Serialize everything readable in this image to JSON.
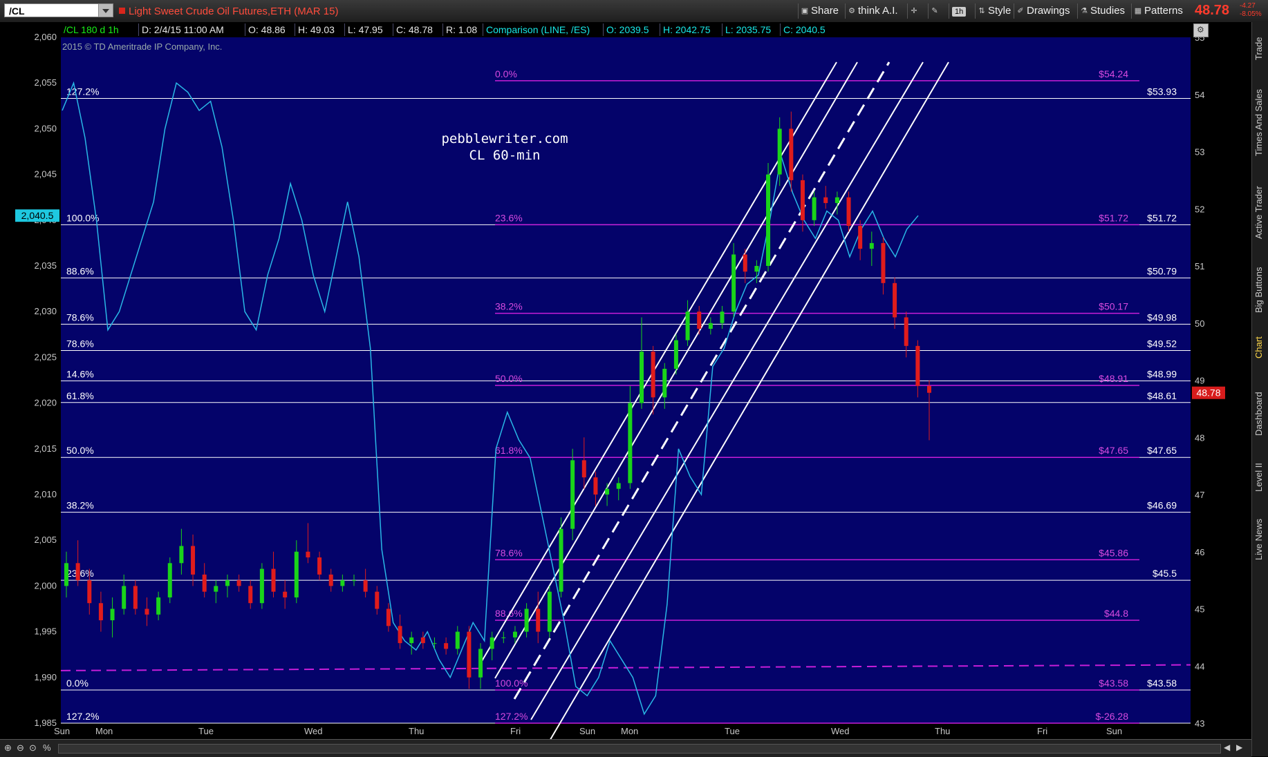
{
  "toolbar": {
    "symbol": "/CL",
    "instrument_title": "Light Sweet Crude Oil Futures,ETH (MAR 15)",
    "share_label": "Share",
    "thinkai_label": "think A.I.",
    "timeframe_badge": "1h",
    "style_label": "Style",
    "drawings_label": "Drawings",
    "studies_label": "Studies",
    "patterns_label": "Patterns",
    "last_price": "48.78",
    "change_abs": "-4.27",
    "change_pct": "-8.05%"
  },
  "infobar": {
    "symbol_period": "/CL 180 d 1h",
    "date": "D: 2/4/15 11:00 AM",
    "open": "O: 48.86",
    "high": "H: 49.03",
    "low": "L: 47.95",
    "close": "C: 48.78",
    "range": "R: 1.08",
    "comparison": "Comparison (LINE, /ES)",
    "cmp_open": "O: 2039.5",
    "cmp_high": "H: 2042.75",
    "cmp_low": "L: 2035.75",
    "cmp_close": "C: 2040.5"
  },
  "watermark": "2015 © TD Ameritrade IP Company, Inc.",
  "annotation": {
    "line1": "pebblewriter.com",
    "line2": "CL 60-min"
  },
  "right_tabs": [
    "Trade",
    "Times And Sales",
    "Active Trader",
    "Big Buttons",
    "Chart",
    "Dashboard",
    "Level II",
    "Live News"
  ],
  "active_tab": "Chart",
  "colors": {
    "background": "#04036a",
    "grid": "#1c1c8a",
    "up": "#1ad41a",
    "down": "#e01c1c",
    "comparison": "#29b8e6",
    "white_fib": "#ffffff",
    "magenta_fib": "#c81ed8",
    "channel": "#ffffff",
    "price_badge": "#d81c1c",
    "cmp_badge": "#1ec8e0"
  },
  "chart_data": {
    "type": "candlestick",
    "primary": "/CL",
    "comparison": "/ES",
    "y_right": {
      "min": 43,
      "max": 55,
      "ticks": [
        43,
        44,
        45,
        46,
        47,
        48,
        49,
        50,
        51,
        52,
        53,
        54,
        55
      ]
    },
    "y_left": {
      "min": 1985,
      "max": 2060,
      "ticks": [
        1985,
        1990,
        1995,
        2000,
        2005,
        2010,
        2015,
        2020,
        2025,
        2030,
        2035,
        2040,
        2045,
        2050,
        2055,
        2060
      ]
    },
    "x_labels": [
      "Sun",
      "Mon",
      "Tue",
      "Wed",
      "Thu",
      "Fri",
      "Sun",
      "Mon",
      "Tue",
      "Wed",
      "Thu",
      "Fri",
      "Sun"
    ],
    "current_price": "48.78",
    "current_cmp": "2,040.5",
    "white_fibs": [
      {
        "label": "127.2%",
        "value": 53.93,
        "price": "$53.93"
      },
      {
        "label": "100.0%",
        "value": 51.72,
        "price": "$51.72"
      },
      {
        "label": "88.6%",
        "value": 50.79,
        "price": "$50.79"
      },
      {
        "label": "78.6%",
        "value": 49.98,
        "price": "$49.98"
      },
      {
        "label": "78.6%",
        "value": 49.52,
        "price": "$49.52"
      },
      {
        "label": "14.6%",
        "value": 48.99,
        "price": "$48.99"
      },
      {
        "label": "61.8%",
        "value": 48.61,
        "price": "$48.61"
      },
      {
        "label": "50.0%",
        "value": 47.65,
        "price": "$47.65"
      },
      {
        "label": "38.2%",
        "value": 46.69,
        "price": "$46.69"
      },
      {
        "label": "23.6%",
        "value": 45.5,
        "price": "$45.5"
      },
      {
        "label": "0.0%",
        "value": 43.58,
        "price": "$43.58"
      },
      {
        "label": "127.2%",
        "value": 43.0,
        "price": ""
      }
    ],
    "magenta_fibs": [
      {
        "label": "0.0%",
        "value": 54.24,
        "price": "$54.24"
      },
      {
        "label": "23.6%",
        "value": 51.72,
        "price": "$51.72"
      },
      {
        "label": "38.2%",
        "value": 50.17,
        "price": "$50.17"
      },
      {
        "label": "50.0%",
        "value": 48.91,
        "price": "$48.91"
      },
      {
        "label": "61.8%",
        "value": 47.65,
        "price": "$47.65"
      },
      {
        "label": "78.6%",
        "value": 45.86,
        "price": "$45.86"
      },
      {
        "label": "88.6%",
        "value": 44.8,
        "price": "$44.8"
      },
      {
        "label": "100.0%",
        "value": 43.58,
        "price": "$43.58"
      },
      {
        "label": "127.2%",
        "value": 43.0,
        "price": "$-26.28"
      }
    ],
    "candles": [
      [
        45.4,
        46.0,
        45.2,
        45.8
      ],
      [
        45.8,
        46.2,
        45.4,
        45.5
      ],
      [
        45.5,
        45.7,
        44.9,
        45.1
      ],
      [
        45.1,
        45.3,
        44.6,
        44.8
      ],
      [
        44.8,
        45.2,
        44.5,
        45.0
      ],
      [
        45.0,
        45.6,
        44.9,
        45.4
      ],
      [
        45.4,
        45.5,
        44.9,
        45.0
      ],
      [
        45.0,
        45.2,
        44.7,
        44.9
      ],
      [
        44.9,
        45.3,
        44.8,
        45.2
      ],
      [
        45.2,
        45.9,
        45.1,
        45.8
      ],
      [
        45.8,
        46.4,
        45.6,
        46.1
      ],
      [
        46.1,
        46.3,
        45.4,
        45.6
      ],
      [
        45.6,
        45.8,
        45.2,
        45.3
      ],
      [
        45.3,
        45.5,
        45.1,
        45.4
      ],
      [
        45.4,
        45.6,
        45.2,
        45.5
      ],
      [
        45.5,
        45.6,
        45.3,
        45.4
      ],
      [
        45.4,
        45.5,
        45.0,
        45.1
      ],
      [
        45.1,
        45.8,
        45.0,
        45.7
      ],
      [
        45.7,
        46.0,
        45.2,
        45.3
      ],
      [
        45.3,
        45.5,
        45.0,
        45.2
      ],
      [
        45.2,
        46.2,
        45.1,
        46.0
      ],
      [
        46.0,
        46.5,
        45.8,
        45.9
      ],
      [
        45.9,
        46.0,
        45.5,
        45.6
      ],
      [
        45.6,
        45.7,
        45.3,
        45.4
      ],
      [
        45.4,
        45.6,
        45.3,
        45.5
      ],
      [
        45.5,
        45.6,
        45.4,
        45.5
      ],
      [
        45.5,
        45.7,
        45.2,
        45.3
      ],
      [
        45.3,
        45.4,
        44.9,
        45.0
      ],
      [
        45.0,
        45.1,
        44.6,
        44.7
      ],
      [
        44.7,
        44.9,
        44.3,
        44.4
      ],
      [
        44.4,
        44.6,
        44.2,
        44.5
      ],
      [
        44.5,
        44.6,
        44.3,
        44.4
      ],
      [
        44.4,
        44.5,
        44.3,
        44.4
      ],
      [
        44.4,
        44.5,
        44.2,
        44.3
      ],
      [
        44.3,
        44.7,
        44.2,
        44.6
      ],
      [
        44.6,
        44.7,
        43.6,
        43.8
      ],
      [
        43.8,
        44.4,
        43.6,
        44.3
      ],
      [
        44.3,
        44.6,
        44.1,
        44.5
      ],
      [
        44.5,
        44.6,
        44.4,
        44.5
      ],
      [
        44.5,
        44.7,
        44.4,
        44.6
      ],
      [
        44.6,
        45.1,
        44.5,
        45.0
      ],
      [
        45.0,
        45.3,
        44.4,
        44.6
      ],
      [
        44.6,
        45.4,
        44.5,
        45.3
      ],
      [
        45.3,
        46.6,
        45.2,
        46.4
      ],
      [
        46.4,
        47.8,
        46.2,
        47.6
      ],
      [
        47.6,
        48.0,
        47.1,
        47.3
      ],
      [
        47.3,
        47.4,
        46.8,
        47.0
      ],
      [
        47.0,
        47.2,
        46.8,
        47.1
      ],
      [
        47.1,
        47.3,
        46.9,
        47.2
      ],
      [
        47.2,
        48.9,
        47.1,
        48.6
      ],
      [
        48.6,
        50.1,
        48.5,
        49.5
      ],
      [
        49.5,
        49.6,
        48.4,
        48.7
      ],
      [
        48.7,
        49.3,
        48.5,
        49.2
      ],
      [
        49.2,
        49.8,
        49.1,
        49.7
      ],
      [
        49.7,
        50.4,
        49.6,
        50.2
      ],
      [
        50.2,
        50.3,
        49.8,
        49.9
      ],
      [
        49.9,
        50.1,
        49.8,
        50.0
      ],
      [
        50.0,
        50.3,
        49.9,
        50.2
      ],
      [
        50.2,
        51.4,
        50.1,
        51.2
      ],
      [
        51.2,
        51.3,
        50.7,
        50.9
      ],
      [
        50.9,
        51.1,
        50.7,
        51.0
      ],
      [
        51.0,
        52.8,
        50.9,
        52.6
      ],
      [
        52.6,
        53.6,
        52.4,
        53.4
      ],
      [
        53.4,
        53.7,
        52.3,
        52.5
      ],
      [
        52.5,
        52.6,
        51.6,
        51.8
      ],
      [
        51.8,
        52.3,
        51.7,
        52.2
      ],
      [
        52.2,
        52.4,
        52.0,
        52.1
      ],
      [
        52.1,
        52.3,
        51.9,
        52.2
      ],
      [
        52.2,
        52.3,
        51.6,
        51.7
      ],
      [
        51.7,
        51.8,
        51.1,
        51.3
      ],
      [
        51.3,
        51.6,
        51.0,
        51.4
      ],
      [
        51.4,
        51.5,
        50.5,
        50.7
      ],
      [
        50.7,
        50.8,
        49.9,
        50.1
      ],
      [
        50.1,
        50.2,
        49.4,
        49.6
      ],
      [
        49.6,
        49.7,
        48.7,
        48.9
      ],
      [
        48.9,
        49.0,
        47.95,
        48.78
      ]
    ],
    "comparison_series": [
      2052,
      2055,
      2049,
      2040,
      2028,
      2030,
      2034,
      2038,
      2042,
      2050,
      2055,
      2054,
      2052,
      2053,
      2048,
      2040,
      2030,
      2028,
      2034,
      2038,
      2044,
      2040,
      2034,
      2030,
      2036,
      2042,
      2036,
      2026,
      2004,
      1996,
      1994,
      1993,
      1995,
      1992,
      1990,
      1993,
      1996,
      1994,
      2015,
      2019,
      2016,
      2014,
      2008,
      2002,
      1996,
      1989,
      1988,
      1990,
      1994,
      1992,
      1990,
      1986,
      1988,
      1998,
      2015,
      2012,
      2010,
      2024,
      2026,
      2030,
      2033,
      2034,
      2040,
      2047,
      2043,
      2040,
      2038,
      2041,
      2040,
      2036,
      2039,
      2041,
      2038,
      2036,
      2039,
      2040.5
    ]
  }
}
